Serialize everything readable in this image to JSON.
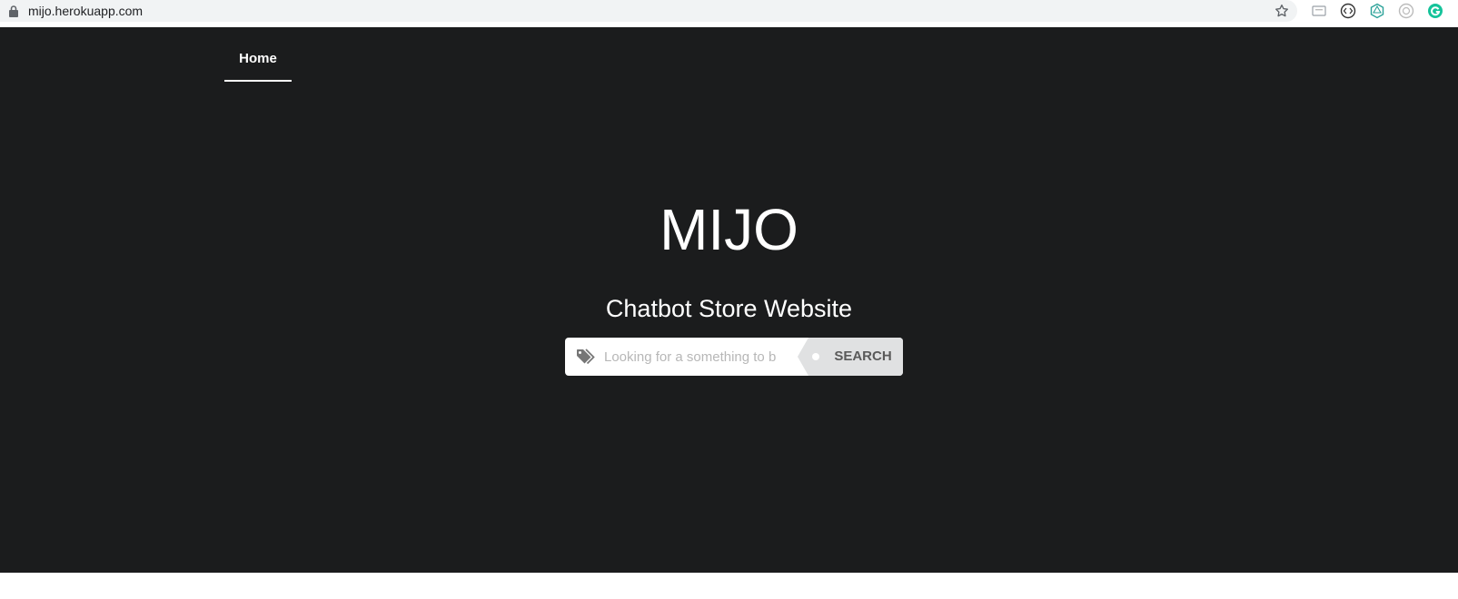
{
  "browser": {
    "url": "mijo.herokuapp.com",
    "icons": [
      "lock-icon",
      "star-icon",
      "extension-icon",
      "extension-icon",
      "extension-icon",
      "extension-icon",
      "grammarly-icon"
    ]
  },
  "nav": {
    "items": [
      {
        "label": "Home",
        "active": true
      }
    ]
  },
  "hero": {
    "title": "MIJO",
    "subtitle": "Chatbot Store Website",
    "background_color": "#1b1c1d"
  },
  "search": {
    "placeholder": "Looking for a something to b",
    "value": "",
    "button_label": "SEARCH",
    "icon": "tag-icon"
  }
}
